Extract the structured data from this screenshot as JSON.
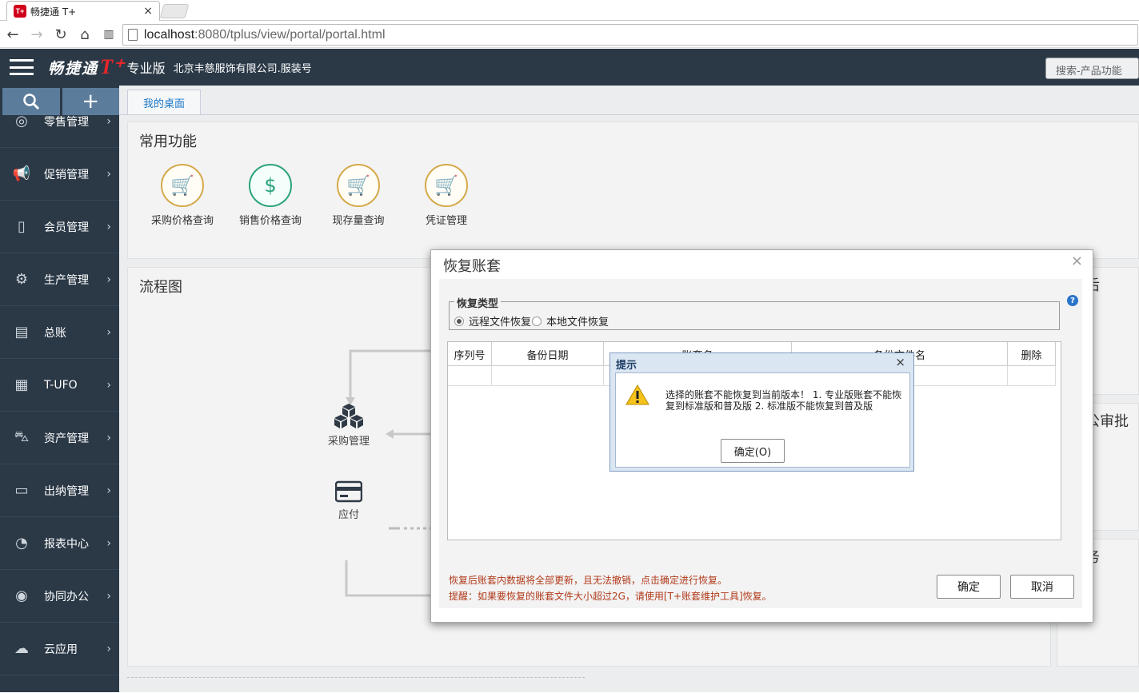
{
  "browser": {
    "tab_title": "畅捷通 T+",
    "tab_close": "×",
    "favicon_text": "T+",
    "url_host": "localhost",
    "url_rest": ":8080/tplus/view/portal/portal.html",
    "nav_back": "←",
    "nav_forward": "→",
    "nav_reload": "↻",
    "nav_home": "⌂",
    "nav_trash": "🗑"
  },
  "header": {
    "logo_text": "畅捷通",
    "logo_tplus": "T⁺",
    "edition": "专业版",
    "company": "北京丰慈服饰有限公司.服装号",
    "search_placeholder": "搜索-产品功能"
  },
  "sidebar": {
    "search_icon": "🔍",
    "plus_icon": "+",
    "items": [
      {
        "label": "零售管理",
        "icon": "◎"
      },
      {
        "label": "促销管理",
        "icon": "📢"
      },
      {
        "label": "会员管理",
        "icon": "▯"
      },
      {
        "label": "生产管理",
        "icon": "⚙"
      },
      {
        "label": "总账",
        "icon": "▤"
      },
      {
        "label": "T-UFO",
        "icon": "▦"
      },
      {
        "label": "资产管理",
        "icon": "⛍"
      },
      {
        "label": "出纳管理",
        "icon": "▭"
      },
      {
        "label": "报表中心",
        "icon": "◔"
      },
      {
        "label": "协同办公",
        "icon": "◉"
      },
      {
        "label": "云应用",
        "icon": "☁"
      }
    ],
    "arrow": "›"
  },
  "main": {
    "tab_label": "我的桌面",
    "common_title": "常用功能",
    "functions": [
      {
        "label": "采购价格查询",
        "icon": "🛒"
      },
      {
        "label": "销售价格查询",
        "icon": "$"
      },
      {
        "label": "现存量查询",
        "icon": "🛒"
      },
      {
        "label": "凭证管理",
        "icon": "🛒"
      }
    ],
    "flow_title": "流程图",
    "flow_nodes": [
      {
        "label": "采购管理",
        "icon": "⬢"
      },
      {
        "label": "应付",
        "icon": "▭"
      }
    ],
    "right_partial_1": "后",
    "right_partial_2": "公审批",
    "right_partial_3": "务"
  },
  "dialog": {
    "title": "恢复账套",
    "close": "×",
    "help": "?",
    "restore_type_legend": "恢复类型",
    "radio_remote": "远程文件恢复",
    "radio_local": "本地文件恢复",
    "columns": [
      "序列号",
      "备份日期",
      "账套名",
      "备份文件名",
      "删除"
    ],
    "note1": "恢复后账套内数据将全部更新，且无法撤销，点击确定进行恢复。",
    "note2": "提醒：如果要恢复的账套文件大小超过2G，请使用[T+账套维护工具]恢复。",
    "ok": "确定",
    "cancel": "取消"
  },
  "alert": {
    "title": "提示",
    "close": "×",
    "message": "选择的账套不能恢复到当前版本！ 1. 专业版账套不能恢复到标准版和普及版 2. 标准版不能恢复到普及版",
    "ok": "确定(O)"
  },
  "colors": {
    "header_bg": "#2b3947",
    "brand_red": "#e8262b",
    "link_blue": "#1a78c8",
    "note_red": "#b03a1a"
  }
}
